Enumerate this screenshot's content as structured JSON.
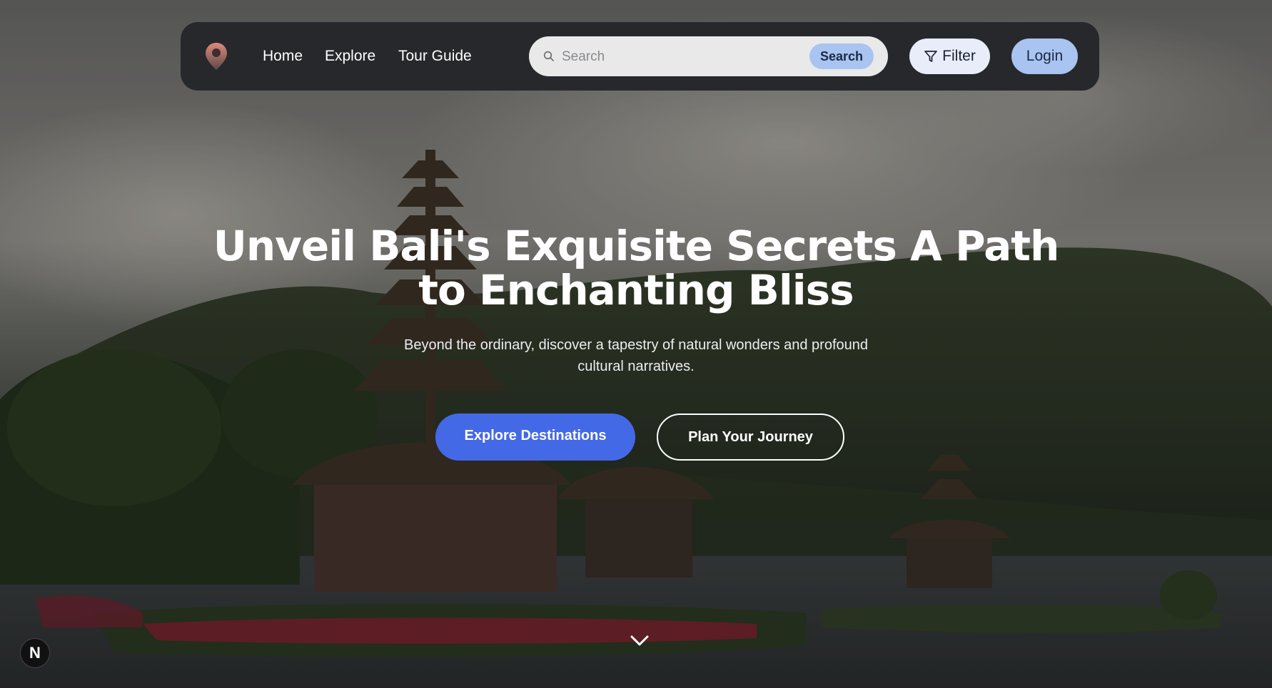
{
  "nav": {
    "links": [
      "Home",
      "Explore",
      "Tour Guide"
    ],
    "search_placeholder": "Search",
    "search_button": "Search",
    "filter_label": "Filter",
    "login_label": "Login"
  },
  "hero": {
    "title": "Unveil Bali's Exquisite Secrets A Path to Enchanting Bliss",
    "subtitle": "Beyond the ordinary, discover a tapestry of natural wonders and profound cultural narratives.",
    "primary_cta": "Explore Destinations",
    "secondary_cta": "Plan Your Journey"
  },
  "badge": {
    "letter": "N"
  },
  "icons": {
    "logo": "map-pin-icon",
    "search": "search-icon",
    "filter": "filter-icon",
    "scroll": "chevron-down-icon"
  },
  "colors": {
    "nav_bg": "#27282b",
    "accent": "#4469e6",
    "light_button": "#a9c4f0",
    "filter_button": "#e8edf9"
  }
}
